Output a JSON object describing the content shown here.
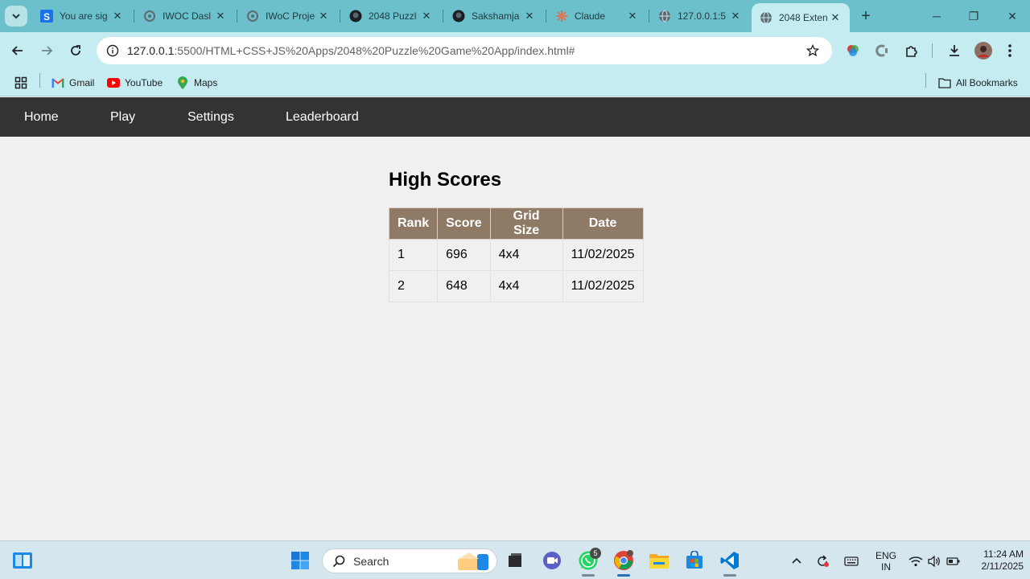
{
  "browser": {
    "tabs": [
      {
        "title": "You are sig",
        "icon": "s-favicon"
      },
      {
        "title": "IWOC Dasl",
        "icon": "iwoc-favicon"
      },
      {
        "title": "IWoC Proje",
        "icon": "iwoc-favicon"
      },
      {
        "title": "2048 Puzzl",
        "icon": "github-favicon"
      },
      {
        "title": "Sakshamja",
        "icon": "github-favicon"
      },
      {
        "title": "Claude",
        "icon": "claude-favicon"
      },
      {
        "title": "127.0.0.1:5",
        "icon": "globe-favicon"
      },
      {
        "title": "2048 Exten",
        "icon": "globe-favicon",
        "active": true
      }
    ],
    "url_host": "127.0.0.1",
    "url_path": ":5500/HTML+CSS+JS%20Apps/2048%20Puzzle%20Game%20App/index.html#",
    "bookmarks": [
      {
        "label": "Gmail",
        "icon": "gmail-icon"
      },
      {
        "label": "YouTube",
        "icon": "youtube-icon"
      },
      {
        "label": "Maps",
        "icon": "maps-icon"
      }
    ],
    "all_bookmarks_label": "All Bookmarks",
    "chrome_color": "#6cc0cc",
    "toolbar_color": "#c4ecf1"
  },
  "page": {
    "nav": [
      "Home",
      "Play",
      "Settings",
      "Leaderboard"
    ],
    "nav_bg": "#333333",
    "title": "High Scores",
    "table_header_color": "#8f7a66",
    "columns": [
      "Rank",
      "Score",
      "Grid Size",
      "Date"
    ],
    "rows": [
      [
        "1",
        "696",
        "4x4",
        "11/02/2025"
      ],
      [
        "2",
        "648",
        "4x4",
        "11/02/2025"
      ]
    ]
  },
  "taskbar": {
    "search_placeholder": "Search",
    "whatsapp_badge": "5",
    "language_line1": "ENG",
    "language_line2": "IN",
    "time": "11:24 AM",
    "date": "2/11/2025"
  }
}
